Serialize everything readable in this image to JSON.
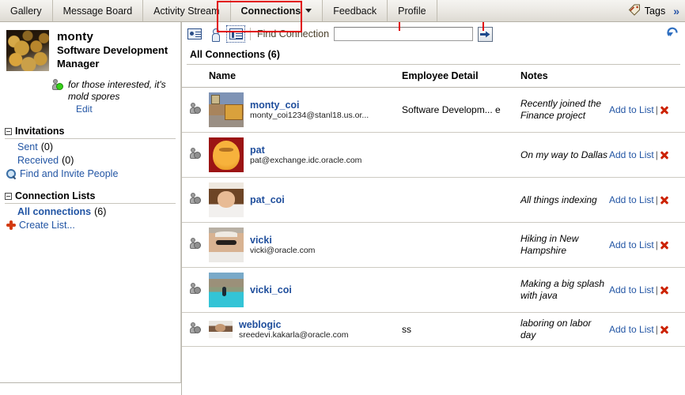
{
  "tabs": [
    {
      "label": "Gallery",
      "active": false,
      "caret": false
    },
    {
      "label": "Message Board",
      "active": false,
      "caret": false
    },
    {
      "label": "Activity Stream",
      "active": false,
      "caret": false
    },
    {
      "label": "Connections",
      "active": true,
      "caret": true
    },
    {
      "label": "Feedback",
      "active": false,
      "caret": false
    },
    {
      "label": "Profile",
      "active": false,
      "caret": false
    }
  ],
  "header": {
    "tags_label": "Tags",
    "tags_icon": "tag-icon",
    "more_chevron": "»",
    "refresh_icon": "refresh-icon"
  },
  "profile": {
    "avatar_icon": "profile-avatar",
    "name": "monty",
    "title": "Software Development Manager",
    "presence_icon": "presence-online-icon",
    "status_message": "for those interested, it's mold spores",
    "edit_label": "Edit"
  },
  "sidebar": {
    "invitations": {
      "heading": "Invitations",
      "expander_icon": "collapse-icon",
      "items": [
        {
          "label": "Sent",
          "count": "(0)",
          "icon": null
        },
        {
          "label": "Received",
          "count": "(0)",
          "icon": null
        },
        {
          "label": "Find and Invite People",
          "count": "",
          "icon": "search-icon"
        }
      ]
    },
    "connection_lists": {
      "heading": "Connection Lists",
      "expander_icon": "collapse-icon",
      "items": [
        {
          "label": "All connections",
          "count": "(6)",
          "icon": null,
          "bold": true
        },
        {
          "label": "Create List...",
          "count": "",
          "icon": "create-list-icon",
          "bold": false
        }
      ]
    }
  },
  "toolbar": {
    "icons": [
      {
        "name": "contact-card-view-icon",
        "selected": false
      },
      {
        "name": "person-view-icon",
        "selected": false
      },
      {
        "name": "list-view-icon",
        "selected": true
      }
    ],
    "find_label": "Find Connection",
    "search_value": "",
    "search_placeholder": "",
    "go_label": "Go",
    "go_icon": "arrow-right-icon"
  },
  "main": {
    "section_title": "All Connections (6)",
    "columns": [
      "",
      "Name",
      "Employee Detail",
      "Notes",
      ""
    ],
    "action_label": "Add to List",
    "action_separator": "|",
    "delete_icon": "delete-icon",
    "rows": [
      {
        "presence_icon": "presence-offline-icon",
        "avatar": "av-bedroom",
        "username": "monty_coi",
        "email": "monty_coi1234@stanl18.us.or...",
        "employee_detail": "Software Developm... e",
        "notes": "Recently joined the Finance project"
      },
      {
        "presence_icon": "presence-offline-icon",
        "avatar": "av-pat",
        "username": "pat",
        "email": "pat@exchange.idc.oracle.com",
        "employee_detail": "",
        "notes": "On my way to Dallas"
      },
      {
        "presence_icon": "presence-offline-icon",
        "avatar": "av-patcoi",
        "username": "pat_coi",
        "email": "",
        "employee_detail": "",
        "notes": "All things indexing"
      },
      {
        "presence_icon": "presence-offline-icon",
        "avatar": "av-vicki",
        "username": "vicki",
        "email": "vicki@oracle.com",
        "employee_detail": "",
        "notes": "Hiking in New Hampshire"
      },
      {
        "presence_icon": "presence-offline-icon",
        "avatar": "av-pool",
        "username": "vicki_coi",
        "email": "",
        "employee_detail": "",
        "notes": "Making a big splash with java"
      },
      {
        "presence_icon": "presence-offline-icon",
        "avatar": "av-weblogic",
        "username": "weblogic",
        "email": "sreedevi.kakarla@oracle.com",
        "employee_detail": "ss",
        "notes": "laboring on labor day"
      }
    ]
  },
  "colors": {
    "link": "#1f4e9c",
    "sidebar_link": "#2255a4",
    "annotation": "#e10000",
    "delete": "#cc2200",
    "online": "#35d219"
  }
}
